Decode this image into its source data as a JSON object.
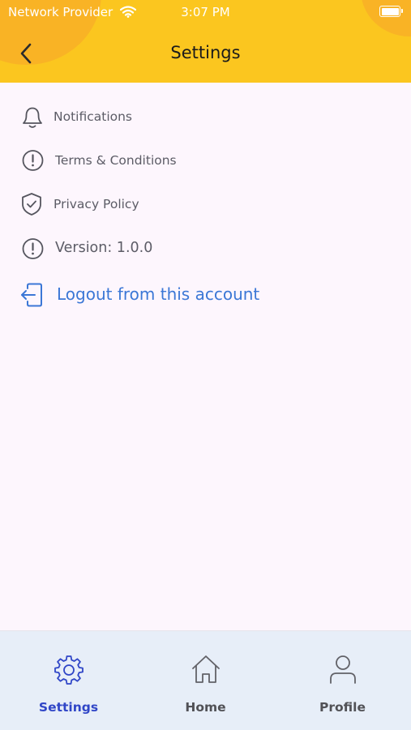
{
  "status_bar": {
    "carrier": "Network Provider",
    "time": "3:07 PM"
  },
  "header": {
    "title": "Settings",
    "back_icon": "chevron-left-icon"
  },
  "menu": {
    "items": [
      {
        "label": "Notifications",
        "icon": "bell-icon"
      },
      {
        "label": "Terms & Conditions",
        "icon": "info-circle-icon"
      },
      {
        "label": "Privacy Policy",
        "icon": "shield-check-icon"
      },
      {
        "label": "Version: 1.0.0",
        "icon": "info-circle-icon"
      }
    ],
    "logout": {
      "label": "Logout from this account",
      "icon": "logout-icon"
    }
  },
  "tabbar": {
    "tabs": [
      {
        "label": "Settings",
        "icon": "gear-icon",
        "active": true
      },
      {
        "label": "Home",
        "icon": "home-icon",
        "active": false
      },
      {
        "label": "Profile",
        "icon": "user-icon",
        "active": false
      }
    ]
  },
  "colors": {
    "header": "#fbc61f",
    "accent": "#3b77d6",
    "tab_active": "#3046c7",
    "background": "#fdf6fd"
  }
}
